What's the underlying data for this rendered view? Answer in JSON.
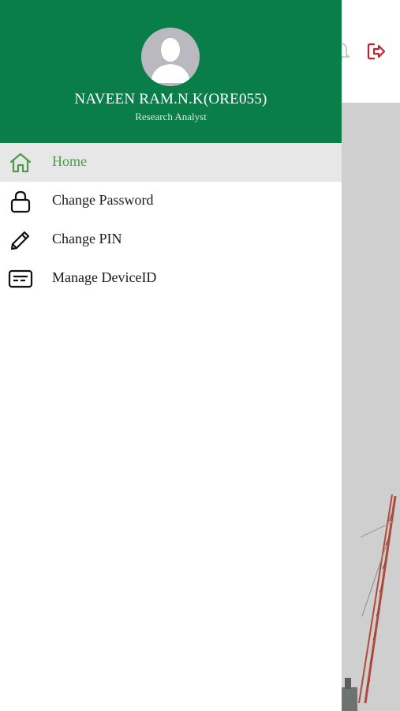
{
  "user": {
    "name": "NAVEEN RAM.N.K(ORE055)",
    "role": "Research Analyst"
  },
  "menu": {
    "items": [
      {
        "label": "Home",
        "icon": "home-icon",
        "active": true
      },
      {
        "label": "Change Password",
        "icon": "lock-icon",
        "active": false
      },
      {
        "label": "Change PIN",
        "icon": "pencil-icon",
        "active": false
      },
      {
        "label": "Manage DeviceID",
        "icon": "device-card-icon",
        "active": false
      }
    ]
  },
  "colors": {
    "header": "#097e49",
    "active_item_bg": "#e7e7e7",
    "active_item_text": "#4f9a4a",
    "logout_icon": "#c8202f",
    "backdrop": "#cfcfcf"
  },
  "background_icons": [
    "bell-icon",
    "logout-icon"
  ]
}
